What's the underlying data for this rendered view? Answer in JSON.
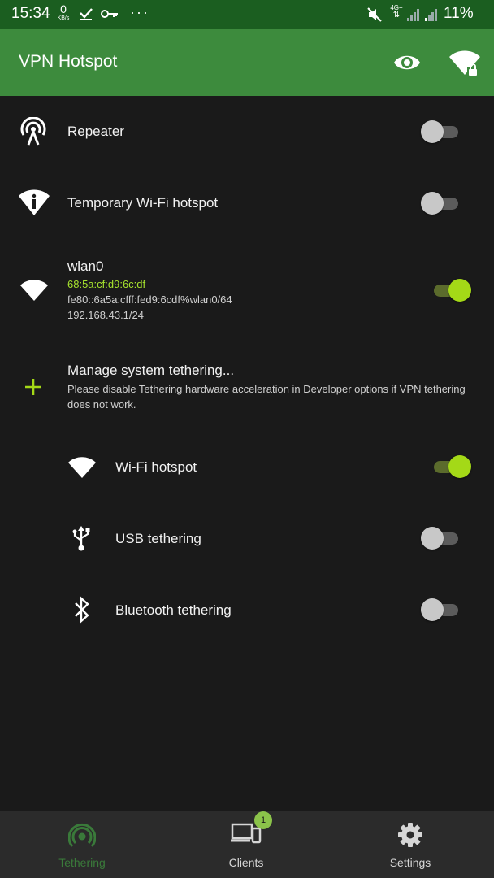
{
  "status_bar": {
    "time": "15:34",
    "net_speed_value": "0",
    "net_speed_unit": "KB/s",
    "more": "···",
    "network_type": "4G+",
    "battery": "11%"
  },
  "app_bar": {
    "title": "VPN Hotspot"
  },
  "interfaces": {
    "repeater": {
      "label": "Repeater",
      "enabled": false
    },
    "temp_hotspot": {
      "label": "Temporary Wi-Fi hotspot",
      "enabled": false
    },
    "wlan0": {
      "label": "wlan0",
      "mac": "68:5a:cf:d9:6c:df",
      "ipv6": "fe80::6a5a:cfff:fed9:6cdf%wlan0/64",
      "ipv4": "192.168.43.1/24",
      "enabled": true
    }
  },
  "manage": {
    "label": "Manage system tethering...",
    "note": "Please disable Tethering hardware acceleration in Developer options if VPN tethering does not work."
  },
  "tethering": {
    "wifi": {
      "label": "Wi-Fi hotspot",
      "enabled": true
    },
    "usb": {
      "label": "USB tethering",
      "enabled": false
    },
    "bluetooth": {
      "label": "Bluetooth tethering",
      "enabled": false
    }
  },
  "bottom_nav": {
    "tethering": "Tethering",
    "clients": "Clients",
    "clients_badge": "1",
    "settings": "Settings",
    "active": "tethering"
  },
  "colors": {
    "status_bar": "#1b5e20",
    "app_bar": "#3d8b3d",
    "background": "#1a1a1a",
    "accent": "#a4d917",
    "link": "#a6e22e"
  }
}
